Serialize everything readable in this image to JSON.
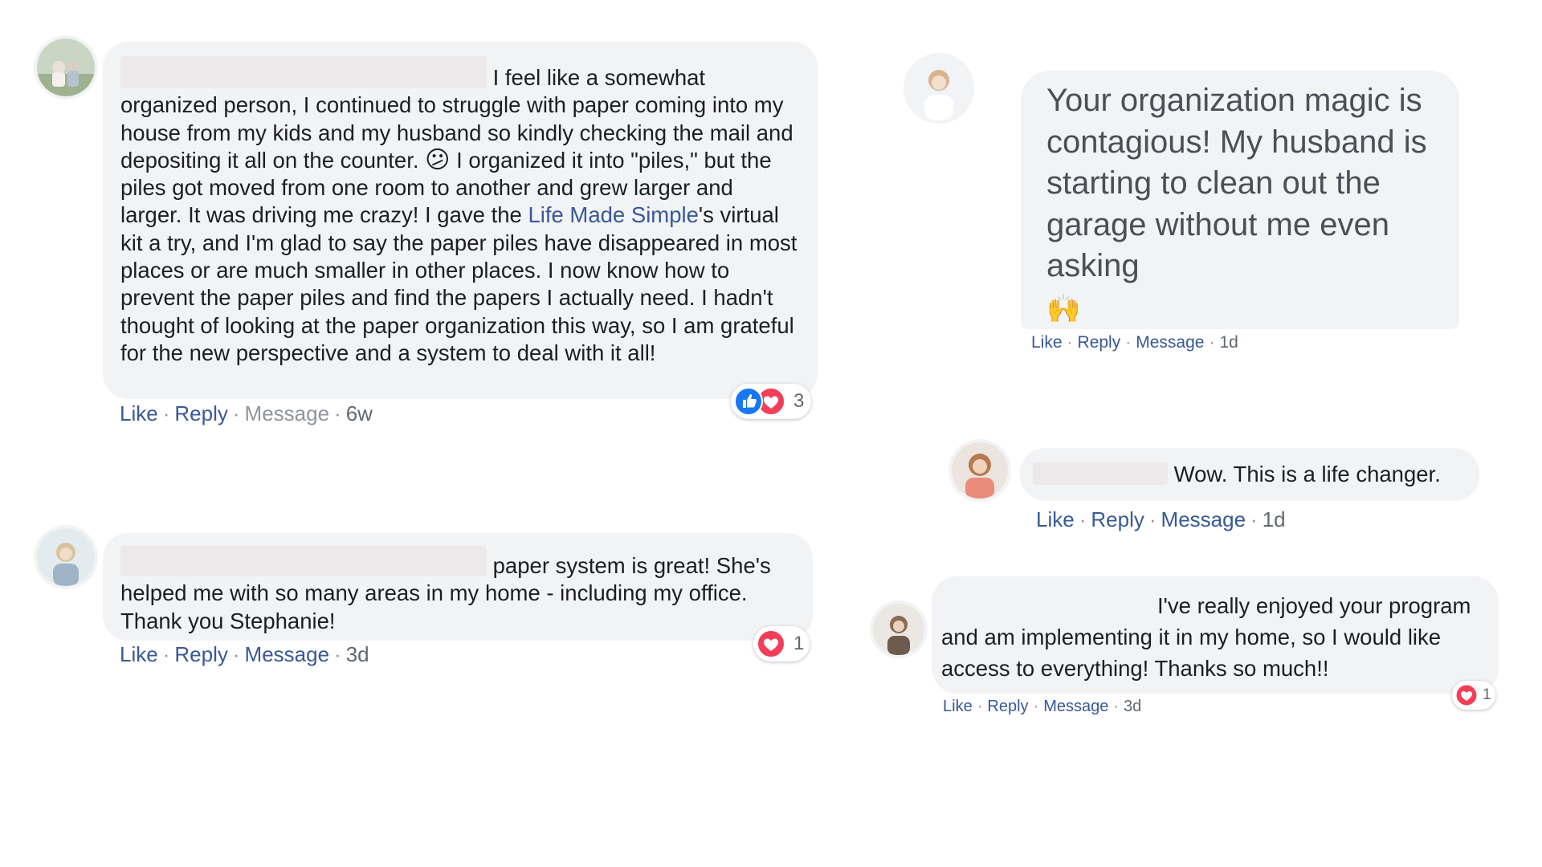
{
  "colors": {
    "bubble": "#f2f3f5",
    "link": "#385898",
    "like_blue": "#1877f2",
    "love_red": "#f33e58",
    "muted": "#90949c"
  },
  "comments": [
    {
      "text_lead": "I feel like a somewhat organized person, I continued to struggle with paper coming into my house from my kids and my husband so kindly checking the mail and depositing it all on the counter.",
      "emoji": "😕",
      "text_mid": "I organized it into \"piles,\" but the piles got moved from one room to another and grew larger and larger. It was driving me crazy! I gave the",
      "link": "Life Made Simple",
      "text_tail": "'s virtual kit a try, and I'm glad to say the paper piles have disappeared in most places or are much smaller in other places. I now know how to prevent the paper piles and find the papers I actually need. I hadn't thought of looking at the paper organization this way, so I am grateful for the new perspective and a system to deal with it all!",
      "actions": {
        "like": "Like",
        "reply": "Reply",
        "message": "Message",
        "time": "6w"
      },
      "reactions": {
        "icons": [
          "like-icon",
          "love-icon"
        ],
        "count": "3"
      }
    },
    {
      "text": "paper system is great! She's helped me with so many areas in my home - including my office. Thank you Stephanie!",
      "actions": {
        "like": "Like",
        "reply": "Reply",
        "message": "Message",
        "time": "3d"
      },
      "reactions": {
        "icons": [
          "love-icon"
        ],
        "count": "1"
      }
    },
    {
      "text": "Your organization magic is contagious!  My husband is starting to clean out the garage without me even asking",
      "emoji": "🙌",
      "actions": {
        "like": "Like",
        "reply": "Reply",
        "message": "Message",
        "time": "1d"
      }
    },
    {
      "text": "Wow. This is a life changer.",
      "actions": {
        "like": "Like",
        "reply": "Reply",
        "message": "Message",
        "time": "1d"
      }
    },
    {
      "text": "I've really enjoyed your program and am implementing it in my home, so I would like access to everything! Thanks so much!!",
      "actions": {
        "like": "Like",
        "reply": "Reply",
        "message": "Message",
        "time": "3d"
      },
      "reactions": {
        "icons": [
          "love-icon"
        ],
        "count": "1"
      }
    }
  ]
}
